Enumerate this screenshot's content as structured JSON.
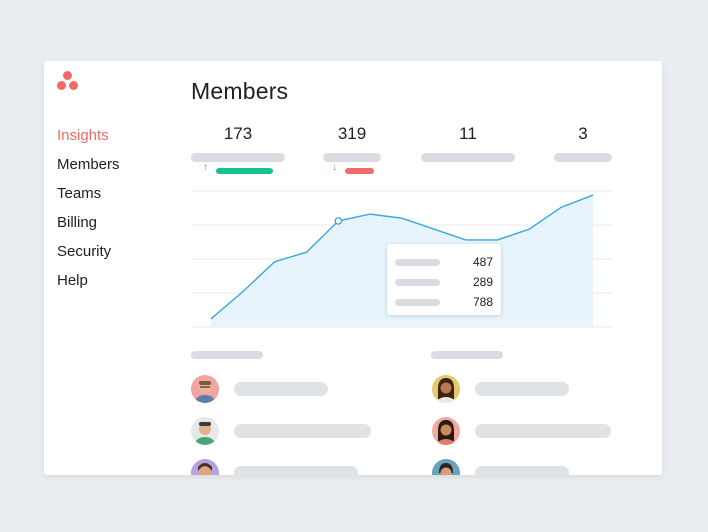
{
  "sidebar": {
    "items": [
      {
        "label": "Insights",
        "active": true
      },
      {
        "label": "Members",
        "active": false
      },
      {
        "label": "Teams",
        "active": false
      },
      {
        "label": "Billing",
        "active": false
      },
      {
        "label": "Security",
        "active": false
      },
      {
        "label": "Help",
        "active": false
      }
    ]
  },
  "main": {
    "title": "Members",
    "stats": [
      {
        "value": "173",
        "trend": "up"
      },
      {
        "value": "319",
        "trend": "down"
      },
      {
        "value": "11"
      },
      {
        "value": "3"
      }
    ],
    "tooltip": {
      "values": [
        "487",
        "289",
        "788"
      ]
    }
  },
  "colors": {
    "accent": "#f06a6a",
    "trend_up": "#14c38e",
    "trend_down": "#f06a6a",
    "chart_line": "#3ba5e6",
    "chart_fill": "#e7f4fd",
    "placeholder": "#d9dde1"
  },
  "chart_data": {
    "type": "area",
    "values": [
      0.06,
      0.26,
      0.48,
      0.55,
      0.78,
      0.83,
      0.8,
      0.72,
      0.64,
      0.64,
      0.72,
      0.88,
      0.97
    ],
    "highlight_index": 4,
    "grid": true
  },
  "icons": {
    "logo": "asana-three-dots-logo",
    "trend_up": "arrow-up-icon",
    "trend_down": "arrow-down-icon"
  }
}
